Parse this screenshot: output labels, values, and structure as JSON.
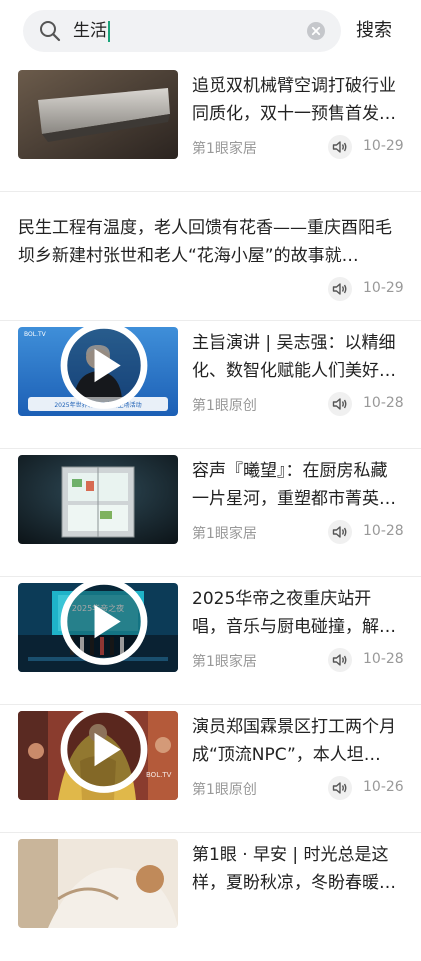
{
  "search": {
    "query": "生活",
    "button_label": "搜索"
  },
  "feed": [
    {
      "title": "追觅双机械臂空调打破行业同质化，双十一预售首发…",
      "source": "第1眼家居",
      "date": "10-29"
    },
    {
      "title": "民生工程有温度，老人回馈有花香——重庆酉阳毛坝乡新建村张世和老人“花海小屋”的故事就…",
      "source": "",
      "date": "10-29"
    },
    {
      "title": "主旨演讲 | 吴志强：以精细化、数智化赋能人们美好…",
      "source": "第1眼原创",
      "date": "10-28",
      "thumb_caption": "2025年世界城市日中国主场活动",
      "thumb_brand": "BOL.TV"
    },
    {
      "title": "容声『曦望』：在厨房私藏一片星河，重塑都市菁英…",
      "source": "第1眼家居",
      "date": "10-28"
    },
    {
      "title": "2025华帝之夜重庆站开唱，音乐与厨电碰撞，解锁“…",
      "source": "第1眼家居",
      "date": "10-28",
      "thumb_caption": "2025华帝之夜"
    },
    {
      "title": "演员郑国霖景区打工两个月成“顶流NPC”，本人坦…",
      "source": "第1眼原创",
      "date": "10-26",
      "thumb_brand": "BOL.TV"
    },
    {
      "title": "第1眼 · 早安 | 时光总是这样，夏盼秋凉，冬盼春暖…",
      "source": "",
      "date": ""
    }
  ],
  "icons": {
    "search": "magnifier-icon",
    "clear": "clear-circle-icon",
    "listen": "speaker-icon",
    "play": "play-icon"
  },
  "colors": {
    "accent": "#1aa37a",
    "meta": "#999999",
    "search_bg": "#f1f2f4"
  }
}
